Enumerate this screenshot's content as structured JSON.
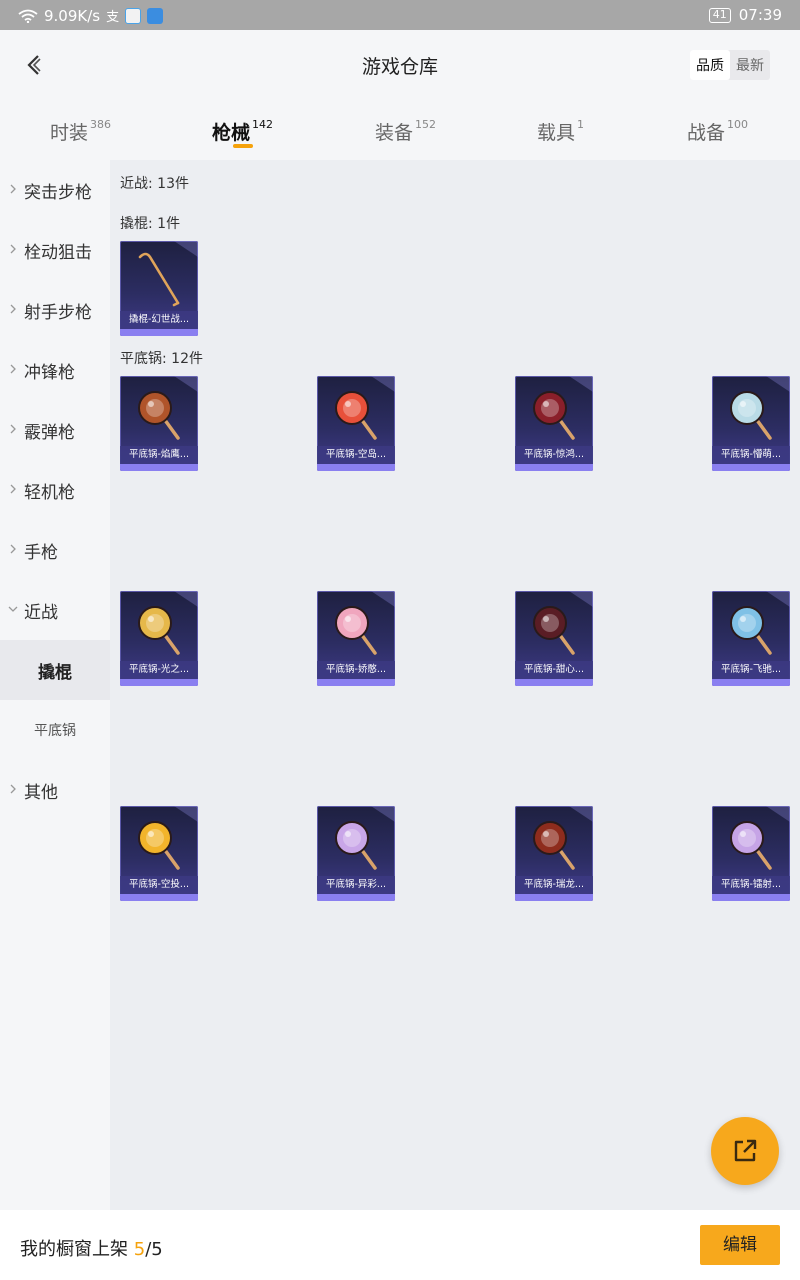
{
  "status_bar": {
    "speed": "9.09K/s",
    "battery": "41",
    "time": "07:39"
  },
  "header": {
    "title": "游戏仓库",
    "sort_quality": "品质",
    "sort_latest": "最新"
  },
  "tabs": [
    {
      "label": "时装",
      "count": "386"
    },
    {
      "label": "枪械",
      "count": "142"
    },
    {
      "label": "装备",
      "count": "152"
    },
    {
      "label": "载具",
      "count": "1"
    },
    {
      "label": "战备",
      "count": "100"
    }
  ],
  "sidebar": [
    {
      "label": "突击步枪"
    },
    {
      "label": "栓动狙击"
    },
    {
      "label": "射手步枪"
    },
    {
      "label": "冲锋枪"
    },
    {
      "label": "霰弹枪"
    },
    {
      "label": "轻机枪"
    },
    {
      "label": "手枪"
    },
    {
      "label": "近战"
    },
    {
      "label": "撬棍"
    },
    {
      "label": "平底锅"
    },
    {
      "label": "其他"
    }
  ],
  "content": {
    "melee_summary": "近战: 13件",
    "crowbar_summary": "撬棍: 1件",
    "pan_summary": "平底锅: 12件",
    "crowbar_items": [
      {
        "name": "撬棍-幻世战..."
      }
    ],
    "pan_items": [
      {
        "name": "平底锅-焰鹰...",
        "color": "#b0542a"
      },
      {
        "name": "平底锅-空岛...",
        "color": "#e8503a"
      },
      {
        "name": "平底锅-惊鸿...",
        "color": "#8a1f2a"
      },
      {
        "name": "平底锅-懵萌...",
        "color": "#b9dbe6"
      },
      {
        "name": "平底锅-光之...",
        "color": "#e6b84a"
      },
      {
        "name": "平底锅-娇憨...",
        "color": "#f0a6be"
      },
      {
        "name": "平底锅-甜心...",
        "color": "#5a1d25"
      },
      {
        "name": "平底锅-飞驰...",
        "color": "#7fc1e6"
      },
      {
        "name": "平底锅-空投...",
        "color": "#f2b42b"
      },
      {
        "name": "平底锅-异彩...",
        "color": "#c9a6e8"
      },
      {
        "name": "平底锅-瑞龙...",
        "color": "#8e2c1d"
      },
      {
        "name": "平底锅-镭射...",
        "color": "#c6a4e6"
      }
    ]
  },
  "bottom": {
    "shelf_label": "我的橱窗上架",
    "shelf_current": "5",
    "shelf_total": "/5",
    "edit_label": "编辑"
  },
  "colors": {
    "accent": "#f5a20c",
    "card_bg": "#2c2d62"
  }
}
